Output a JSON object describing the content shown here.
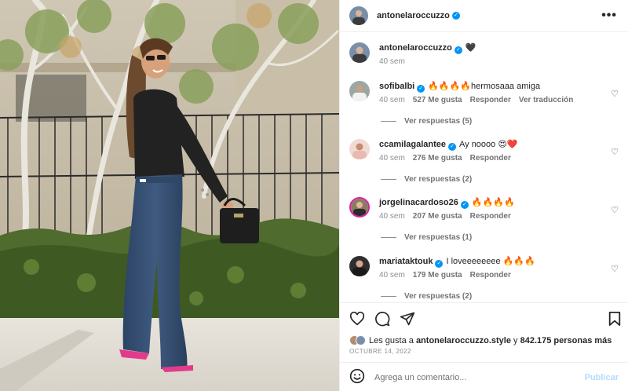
{
  "post": {
    "author": "antonelaroccuzzo",
    "caption": "🖤",
    "caption_time": "40 sem",
    "more_label": "•••"
  },
  "comments": [
    {
      "user": "sofibalbi",
      "text": "🔥🔥🔥🔥hermosaaa amiga",
      "time": "40 sem",
      "likes": "527 Me gusta",
      "reply": "Responder",
      "translate": "Ver traducción",
      "replies": "Ver respuestas (5)"
    },
    {
      "user": "ccamilagalantee",
      "text": "Ay noooo 😍❤️",
      "time": "40 sem",
      "likes": "276 Me gusta",
      "reply": "Responder",
      "replies": "Ver respuestas (2)"
    },
    {
      "user": "jorgelinacardoso26",
      "text": "🔥🔥🔥🔥",
      "time": "40 sem",
      "likes": "207 Me gusta",
      "reply": "Responder",
      "replies": "Ver respuestas (1)"
    },
    {
      "user": "mariataktouk",
      "text": "I loveeeeeeee 🔥🔥🔥",
      "time": "40 sem",
      "likes": "179 Me gusta",
      "reply": "Responder",
      "replies": "Ver respuestas (2)"
    }
  ],
  "likes": {
    "prefix": "Les gusta a",
    "user": "antonelaroccuzzo.style",
    "connector": "y",
    "others": "842.175 personas más"
  },
  "date": "OCTUBRE 14, 2022",
  "comment_box": {
    "placeholder": "Agrega un comentario...",
    "publish": "Publicar"
  },
  "colors": {
    "verified": "#0095f6",
    "publish_disabled": "#b3dbff",
    "meta_text": "#8e8e8e"
  },
  "icons": [
    "heart-icon",
    "comment-icon",
    "share-icon",
    "bookmark-icon",
    "emoji-icon",
    "more-icon",
    "verified-badge-icon"
  ]
}
